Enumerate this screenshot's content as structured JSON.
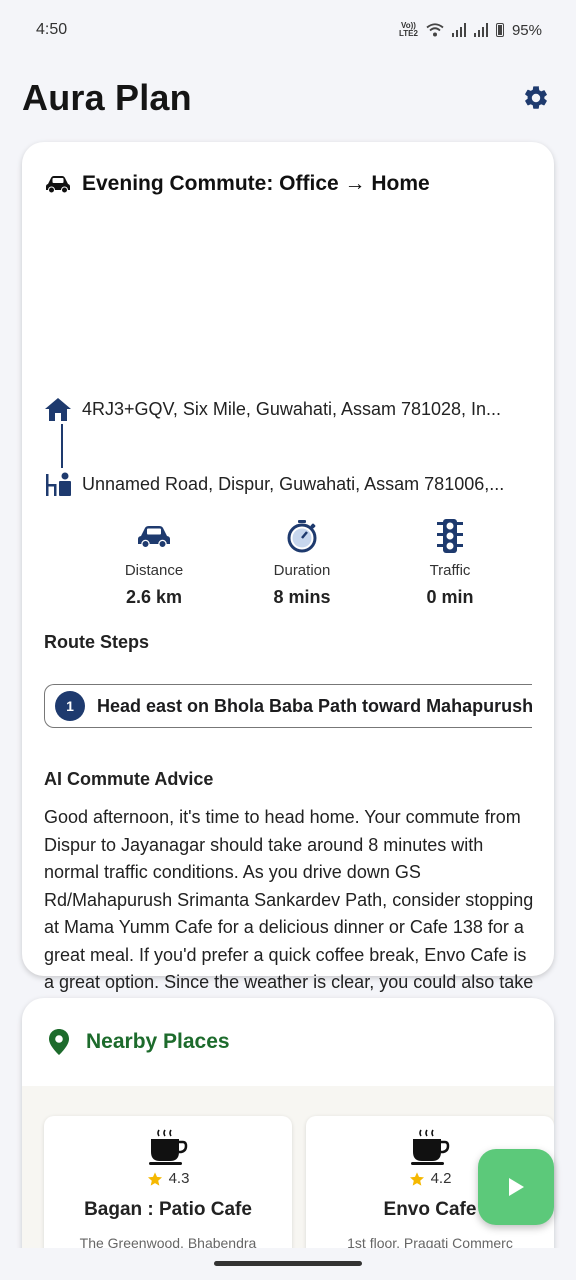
{
  "status_bar": {
    "time": "4:50",
    "lte_label": "Vo))\nLTE2",
    "battery": "95%"
  },
  "header": {
    "title": "Aura Plan",
    "settings_icon": "gear-icon"
  },
  "commute": {
    "title": "Evening Commute: Office → Home",
    "origin": "4RJ3+GQV, Six Mile, Guwahati, Assam 781028, In...",
    "destination": "Unnamed Road, Dispur, Guwahati, Assam 781006,...",
    "stats": [
      {
        "label": "Distance",
        "value": "2.6 km",
        "icon": "car-icon"
      },
      {
        "label": "Duration",
        "value": "8 mins",
        "icon": "stopwatch-icon"
      },
      {
        "label": "Traffic",
        "value": "0 min",
        "icon": "traffic-light-icon"
      }
    ],
    "route_steps_label": "Route Steps",
    "steps": [
      {
        "number": "1",
        "text": "Head east on Bhola Baba Path toward Mahapurush"
      }
    ],
    "advice_label": "AI Commute Advice",
    "advice": "Good afternoon, it's time to head home. Your commute from Dispur to Jayanagar should take around 8 minutes with normal traffic conditions. As you drive down GS Rd/Mahapurush Srimanta Sankardev Path, consider stopping at Mama Yumm Cafe for a delicious dinner or Cafe 138 for a great meal. If you'd prefer a quick coffee break, Envo Cafe is a great option. Since the weather is clear, you could also take a short walk around the area before heading home. Whatever you choose, make the most of your evening commute and unwind after a productive day."
  },
  "nearby": {
    "title": "Nearby Places",
    "places": [
      {
        "name": "Bagan : Patio Cafe",
        "rating": "4.3",
        "address": "The Greenwood, Bhabendra",
        "icon": "coffee-cup-icon"
      },
      {
        "name": "Envo Cafe",
        "rating": "4.2",
        "address": "1st floor, Pragati Commerc",
        "icon": "coffee-cup-icon"
      }
    ]
  },
  "colors": {
    "accent_navy": "#1e3a6e",
    "places_green": "#1d6b2c",
    "fab_green": "#5cc97a",
    "star": "#f5b800"
  }
}
